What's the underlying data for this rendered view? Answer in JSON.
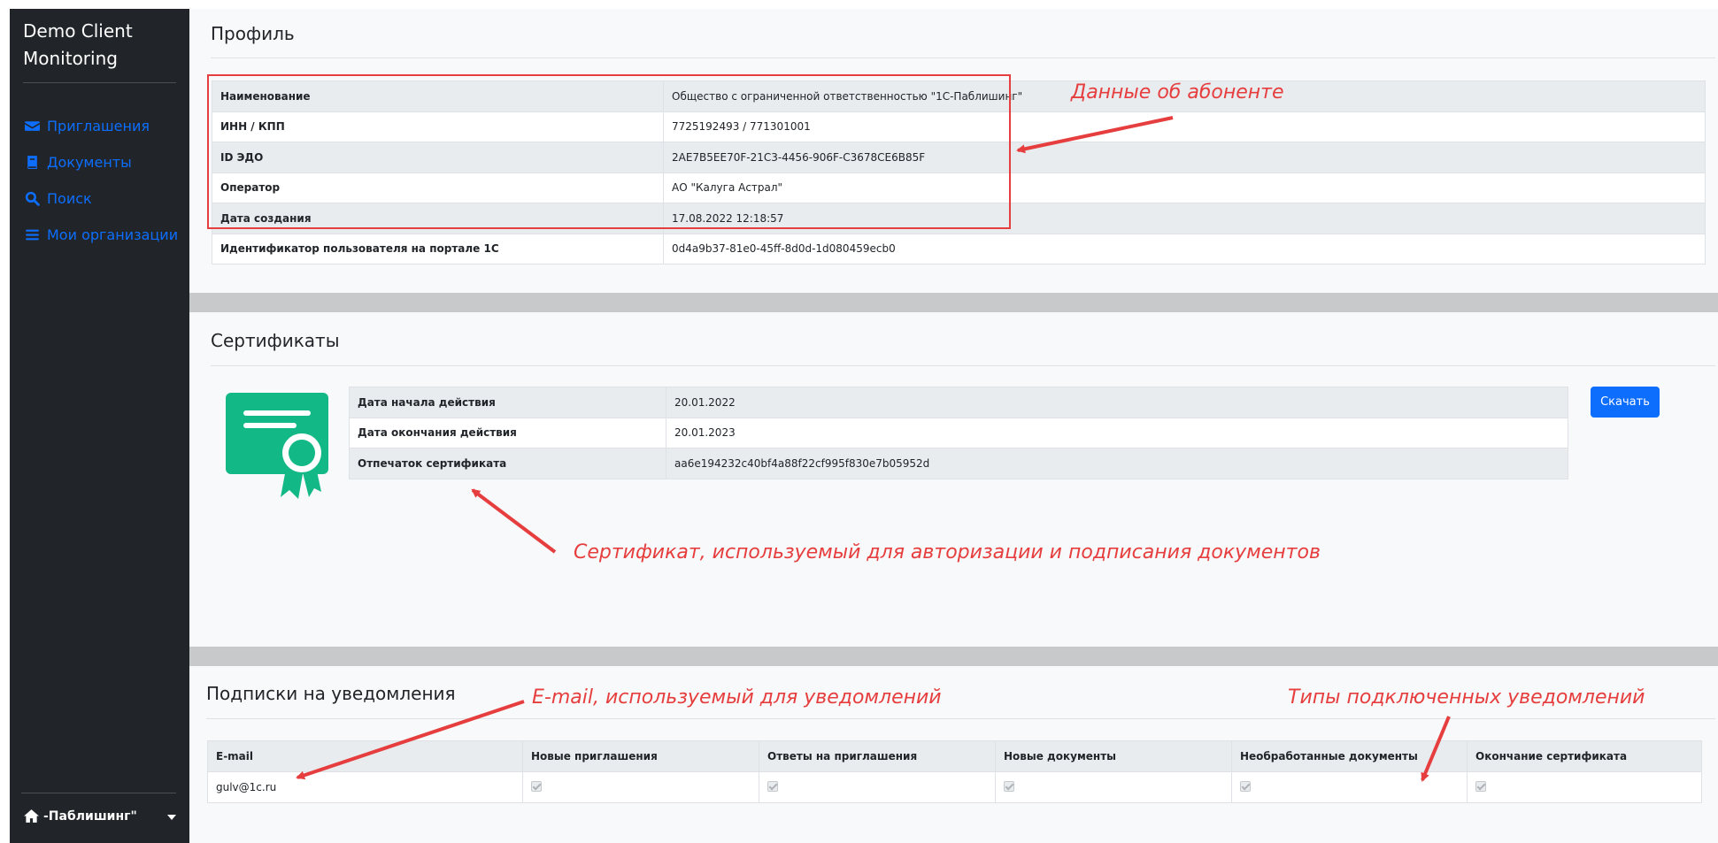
{
  "brand": {
    "line1": "Demo Client",
    "line2": "Monitoring"
  },
  "nav": [
    {
      "label": "Приглашения",
      "icon": "envelope-icon"
    },
    {
      "label": "Документы",
      "icon": "book-icon"
    },
    {
      "label": "Поиск",
      "icon": "search-icon"
    },
    {
      "label": "Мои организации",
      "icon": "list-icon"
    }
  ],
  "org_switch": {
    "label": "-Паблишинг\"",
    "icon": "home-icon"
  },
  "profile": {
    "title": "Профиль",
    "rows": [
      {
        "key": "Наименование",
        "value": "Общество с ограниченной ответственностью \"1С-Паблишинг\""
      },
      {
        "key": "ИНН / КПП",
        "value": "7725192493 / 771301001"
      },
      {
        "key": "ID ЭДО",
        "value": "2AE7B5EE70F-21C3-4456-906F-C3678CE6B85F"
      },
      {
        "key": "Оператор",
        "value": "АО \"Калуга Астрал\""
      },
      {
        "key": "Дата создания",
        "value": "17.08.2022 12:18:57"
      },
      {
        "key": "Идентификатор пользователя на портале 1С",
        "value": "0d4a9b37-81e0-45ff-8d0d-1d080459ecb0"
      }
    ]
  },
  "certificates": {
    "title": "Сертификаты",
    "download_label": "Скачать",
    "rows": [
      {
        "key": "Дата начала действия",
        "value": "20.01.2022"
      },
      {
        "key": "Дата окончания действия",
        "value": "20.01.2023"
      },
      {
        "key": "Отпечаток сертификата",
        "value": "aa6e194232c40bf4a88f22cf995f830e7b05952d"
      }
    ]
  },
  "subscriptions": {
    "title": "Подписки на уведомления",
    "headers": [
      "E-mail",
      "Новые приглашения",
      "Ответы на приглашения",
      "Новые документы",
      "Необработанные документы",
      "Окончание сертификата"
    ],
    "rows": [
      {
        "email": "gulv@1c.ru",
        "checks": [
          true,
          true,
          true,
          true,
          true
        ]
      }
    ]
  },
  "annotations": {
    "subscriber": "Данные об абоненте",
    "certificate": "Сертификат, используемый для авторизации и подписания документов",
    "email": "E-mail, используемый для уведомлений",
    "types": "Типы подключенных уведомлений"
  },
  "colors": {
    "sidebar": "#212529",
    "link": "#0d6efd",
    "annotation": "#e63e3e",
    "cert_green": "#12b886",
    "band": "#c8c9ca"
  }
}
